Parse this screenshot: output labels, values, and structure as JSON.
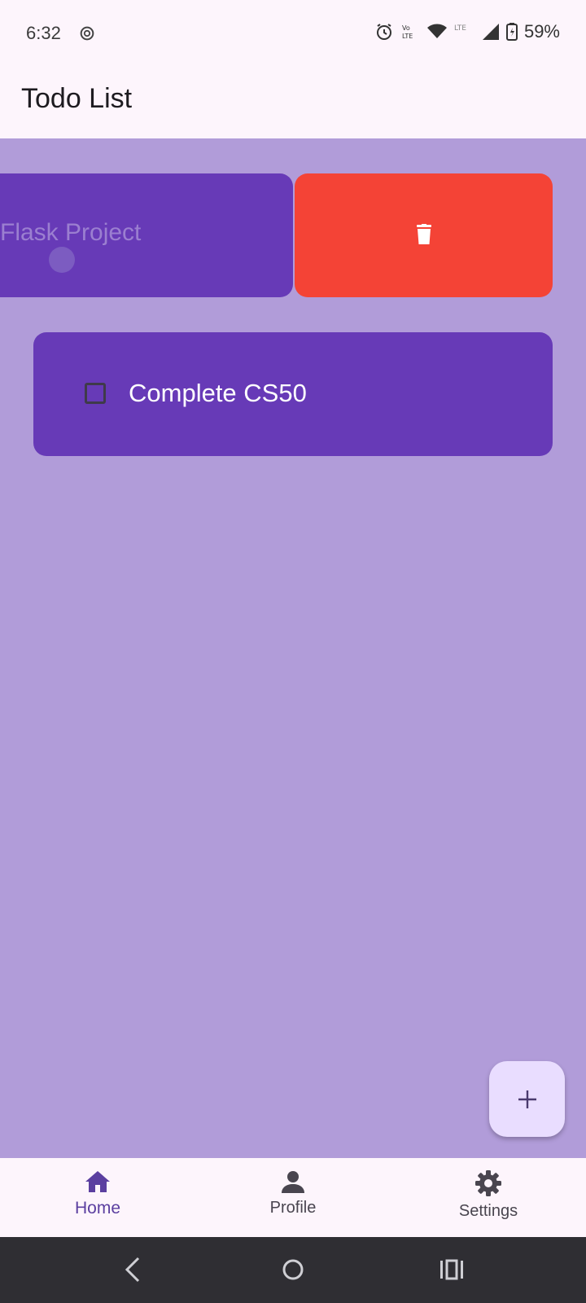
{
  "status_bar": {
    "time": "6:32",
    "battery": "59%",
    "icons": [
      "settings-icon",
      "alarm-icon",
      "volte-icon",
      "wifi-icon",
      "lte-icon",
      "signal-icon",
      "battery-icon"
    ]
  },
  "app_bar": {
    "title": "Todo List"
  },
  "todos": [
    {
      "text": "Flask Project",
      "state": "swiping-to-delete"
    },
    {
      "text": "Complete CS50",
      "checked": false
    }
  ],
  "bottom_nav": {
    "items": [
      {
        "label": "Home",
        "icon": "home-icon",
        "selected": true
      },
      {
        "label": "Profile",
        "icon": "person-icon",
        "selected": false
      },
      {
        "label": "Settings",
        "icon": "settings-icon",
        "selected": false
      }
    ]
  },
  "colors": {
    "background": "#b19cd9",
    "card": "#673ab7",
    "delete": "#f44336",
    "fab": "#e9ddff",
    "bar": "#fdf5fc",
    "accent": "#5b3fa0"
  }
}
